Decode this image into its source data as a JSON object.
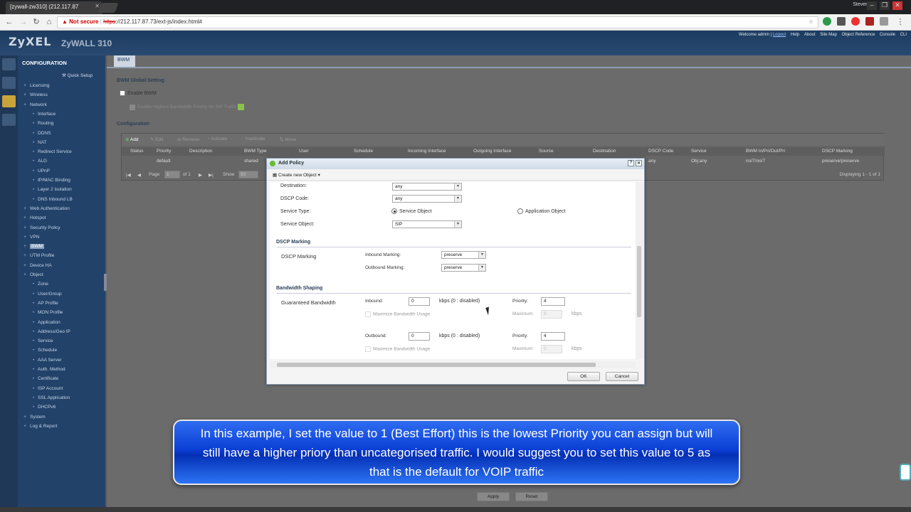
{
  "browser": {
    "tab_title": "[zywall-zw310] (212.117.87",
    "url_warning": "Not secure",
    "url_scheme": "https",
    "url_rest": "://212.117.87.73/ext-js/index.html#",
    "profile": "Steven"
  },
  "header": {
    "brand": "ZyXEL",
    "model": "ZyWALL 310",
    "welcome": "Welcome admin",
    "logout": "Logout",
    "links": [
      "Help",
      "About",
      "Site Map",
      "Object Reference",
      "Console",
      "CLI"
    ]
  },
  "sidebar": {
    "title": "CONFIGURATION",
    "quick_setup": "Quick Setup",
    "items": [
      {
        "label": "Licensing",
        "level": 0
      },
      {
        "label": "Wireless",
        "level": 0
      },
      {
        "label": "Network",
        "level": 0
      },
      {
        "label": "Interface",
        "level": 1
      },
      {
        "label": "Routing",
        "level": 1
      },
      {
        "label": "DDNS",
        "level": 1
      },
      {
        "label": "NAT",
        "level": 1
      },
      {
        "label": "Redirect Service",
        "level": 1
      },
      {
        "label": "ALG",
        "level": 1
      },
      {
        "label": "UPnP",
        "level": 1
      },
      {
        "label": "IP/MAC Binding",
        "level": 1
      },
      {
        "label": "Layer 2 Isolation",
        "level": 1
      },
      {
        "label": "DNS Inbound LB",
        "level": 1
      },
      {
        "label": "Web Authentication",
        "level": 0
      },
      {
        "label": "Hotspot",
        "level": 0
      },
      {
        "label": "Security Policy",
        "level": 0
      },
      {
        "label": "VPN",
        "level": 0
      },
      {
        "label": "BWM",
        "level": 0,
        "selected": true
      },
      {
        "label": "UTM Profile",
        "level": 0
      },
      {
        "label": "Device HA",
        "level": 0
      },
      {
        "label": "Object",
        "level": 0
      },
      {
        "label": "Zone",
        "level": 1
      },
      {
        "label": "User/Group",
        "level": 1
      },
      {
        "label": "AP Profile",
        "level": 1
      },
      {
        "label": "MON Profile",
        "level": 1
      },
      {
        "label": "Application",
        "level": 1
      },
      {
        "label": "Address/Geo IP",
        "level": 1
      },
      {
        "label": "Service",
        "level": 1
      },
      {
        "label": "Schedule",
        "level": 1
      },
      {
        "label": "AAA Server",
        "level": 1
      },
      {
        "label": "Auth. Method",
        "level": 1
      },
      {
        "label": "Certificate",
        "level": 1
      },
      {
        "label": "ISP Account",
        "level": 1
      },
      {
        "label": "SSL Application",
        "level": 1
      },
      {
        "label": "DHCPv6",
        "level": 1
      },
      {
        "label": "System",
        "level": 0
      },
      {
        "label": "Log & Report",
        "level": 0
      }
    ]
  },
  "page": {
    "tab": "BWM",
    "global_title": "BWM Global Setting",
    "enable_bwm": "Enable BWM",
    "enable_sip": "Enable Highest Bandwidth Priority for SIP Traffic",
    "config_title": "Configuration",
    "toolbar": [
      "Add",
      "Edit",
      "Remove",
      "Activate",
      "Inactivate",
      "Move"
    ],
    "columns": [
      "Status",
      "Priority",
      "Description",
      "BWM Type",
      "User",
      "Schedule",
      "Incoming Interface",
      "Outgoing Interface",
      "Source",
      "Destination",
      "DSCP Code",
      "Service",
      "BWM In/Pri/Out/Pri",
      "DSCP Marking"
    ],
    "row": {
      "priority": "default",
      "bwm_type": "shared",
      "dscp_code": "any",
      "service": "Obj:any",
      "bwm": "no/7/no/7",
      "dscp_marking": "preserve/preserve"
    },
    "pager": {
      "page_label": "Page",
      "page": "1",
      "of": "of 1",
      "show": "Show",
      "show_value": "50",
      "displaying": "Displaying 1 - 1 of 1"
    },
    "apply": "Apply",
    "reset": "Reset"
  },
  "dialog": {
    "title": "Add Policy",
    "create_new": "Create new Object",
    "destination_label": "Destination:",
    "destination_value": "any",
    "dscp_code_label": "DSCP Code:",
    "dscp_code_value": "any",
    "service_type_label": "Service Type:",
    "service_object_option": "Service Object",
    "application_object_option": "Application Object",
    "service_object_label": "Service Object:",
    "service_object_value": "SIP",
    "dscp_section": "DSCP Marking",
    "dscp_marking_label": "DSCP Marking",
    "inbound_marking_label": "Inbound Marking:",
    "inbound_marking_value": "preserve",
    "outbound_marking_label": "Outbound Marking:",
    "outbound_marking_value": "preserve",
    "bw_section": "Bandwidth Shaping",
    "guaranteed_label": "Guaranteed Bandwidth",
    "inbound_label": "Inbound:",
    "inbound_value": "0",
    "kbps_disabled": "kbps (0 : disabled)",
    "priority_label": "Priority:",
    "inbound_priority": "4",
    "maximize_label": "Maximize Bandwidth Usage",
    "maximum_label": "Maximum:",
    "maximum_value": "0",
    "kbps": "kbps",
    "outbound_label": "Outbound:",
    "outbound_value": "0",
    "outbound_priority": "4",
    "ok": "OK",
    "cancel": "Cancel"
  },
  "caption": "In this example, I set the value to 1 (Best Effort) this is the lowest Priority you can assign but will still have a higher priory than uncategorised traffic. I would suggest you to set this value to 5 as that is the default for VOIP traffic"
}
